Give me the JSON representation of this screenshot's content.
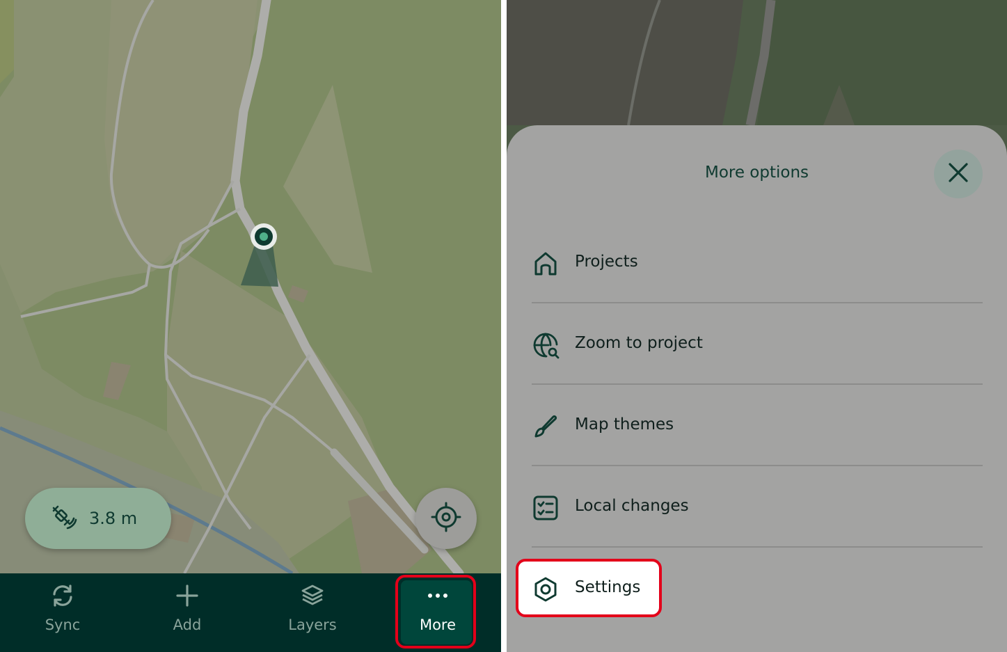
{
  "map_view": {
    "gps_accuracy": "3.8 m",
    "icons": {
      "gps": "satellite-icon",
      "locate": "crosshair-icon"
    }
  },
  "bottom_nav": {
    "items": [
      {
        "label": "Sync",
        "icon": "sync-icon"
      },
      {
        "label": "Add",
        "icon": "plus-icon"
      },
      {
        "label": "Layers",
        "icon": "layers-icon"
      },
      {
        "label": "More",
        "icon": "more-dots-icon"
      }
    ],
    "active": "More"
  },
  "more_options": {
    "title": "More options",
    "close_icon": "close-icon",
    "items": [
      {
        "label": "Projects",
        "icon": "home-icon"
      },
      {
        "label": "Zoom to project",
        "icon": "globe-search-icon"
      },
      {
        "label": "Map themes",
        "icon": "brush-icon"
      },
      {
        "label": "Local changes",
        "icon": "checklist-icon"
      },
      {
        "label": "Settings",
        "icon": "gear-icon"
      }
    ]
  },
  "colors": {
    "nav_background": "#002d28",
    "accent_dark_green": "#00463b",
    "highlight_red": "#e3001a",
    "map_green": "#7e8c64",
    "text_dark_green": "#0f3a30"
  }
}
